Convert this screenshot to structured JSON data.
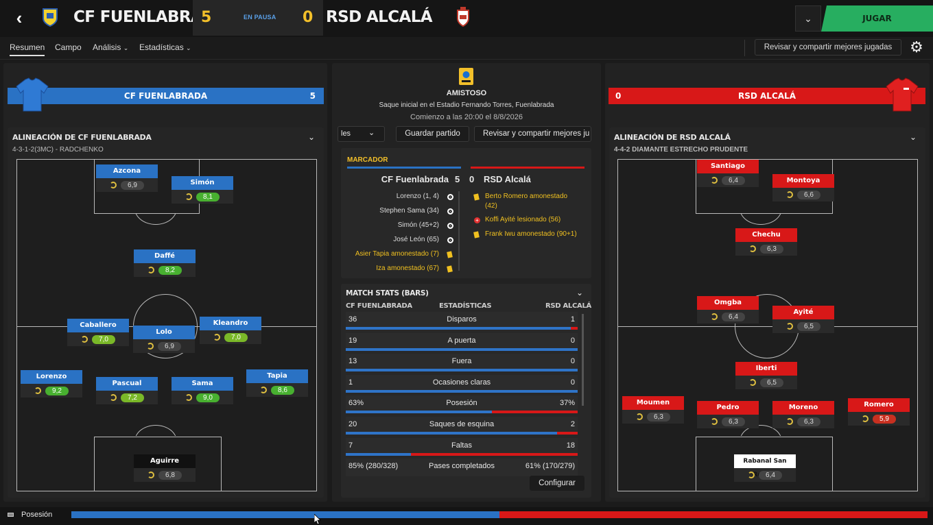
{
  "header": {
    "home_team": "CF FUENLABRADA",
    "home_score": "5",
    "status": "EN PAUSA",
    "away_score": "0",
    "away_team": "RSD ALCALÁ",
    "play_label": "JUGAR"
  },
  "tabs": [
    {
      "label": "Resumen"
    },
    {
      "label": "Campo"
    },
    {
      "label": "Análisis"
    },
    {
      "label": "Estadísticas"
    }
  ],
  "toolbar": {
    "review_label": "Revisar y compartir mejores jugadas"
  },
  "home_panel": {
    "team_label": "CF FUENLABRADA",
    "score": "5",
    "lineup_title": "ALINEACIÓN DE CF FUENLABRADA",
    "formation": "4-3-1-2(3MC) - RADCHENKO",
    "players": [
      {
        "name": "Azcona",
        "rating": "6,9",
        "grade": "none"
      },
      {
        "name": "Simón",
        "rating": "8,1",
        "grade": "green"
      },
      {
        "name": "Daffé",
        "rating": "8,2",
        "grade": "green"
      },
      {
        "name": "Caballero",
        "rating": "7,0",
        "grade": "lime"
      },
      {
        "name": "Lolo",
        "rating": "6,9",
        "grade": "none"
      },
      {
        "name": "Kleandro",
        "rating": "7,0",
        "grade": "lime"
      },
      {
        "name": "Lorenzo",
        "rating": "9,2",
        "grade": "green"
      },
      {
        "name": "Pascual",
        "rating": "7,2",
        "grade": "lime"
      },
      {
        "name": "Sama",
        "rating": "9,0",
        "grade": "green"
      },
      {
        "name": "Tapia",
        "rating": "8,6",
        "grade": "green"
      },
      {
        "name": "Aguirre",
        "rating": "6,8",
        "grade": "none"
      }
    ]
  },
  "away_panel": {
    "team_label": "RSD ALCALÁ",
    "score": "0",
    "lineup_title": "ALINEACIÓN DE RSD ALCALÁ",
    "formation": "4-4-2 DIAMANTE ESTRECHO PRUDENTE",
    "players": [
      {
        "name": "Santiago",
        "rating": "6,4",
        "grade": "none"
      },
      {
        "name": "Montoya",
        "rating": "6,6",
        "grade": "none"
      },
      {
        "name": "Chechu",
        "rating": "6,3",
        "grade": "none"
      },
      {
        "name": "Omgba",
        "rating": "6,4",
        "grade": "none"
      },
      {
        "name": "Ayité",
        "rating": "6,5",
        "grade": "none"
      },
      {
        "name": "Iberti",
        "rating": "6,5",
        "grade": "none"
      },
      {
        "name": "Moumen",
        "rating": "6,3",
        "grade": "none"
      },
      {
        "name": "Pedro",
        "rating": "6,3",
        "grade": "none"
      },
      {
        "name": "Moreno",
        "rating": "6,3",
        "grade": "none"
      },
      {
        "name": "Romero",
        "rating": "5,9",
        "grade": "red"
      },
      {
        "name": "Rabanal San Román",
        "rating": "6,4",
        "grade": "none"
      }
    ]
  },
  "match_info": {
    "competition": "AMISTOSO",
    "venue": "Saque inicial en el Estadio Fernando Torres, Fuenlabrada",
    "kickoff": "Comienzo a las 20:00 el 8/8/2026",
    "dropdown_text": "les",
    "save_label": "Guardar partido",
    "review_label": "Revisar y compartir mejores ju"
  },
  "scoreboard": {
    "title": "MARCADOR",
    "home": "CF Fuenlabrada",
    "home_score": "5",
    "away_score": "0",
    "away": "RSD Alcalá",
    "home_events": [
      {
        "text": "Lorenzo (1, 4)",
        "type": "goal"
      },
      {
        "text": "Stephen Sama (34)",
        "type": "goal"
      },
      {
        "text": "Simón (45+2)",
        "type": "goal"
      },
      {
        "text": "José León (65)",
        "type": "goal"
      },
      {
        "text": "Asier Tapia amonestado (7)",
        "type": "yellow"
      },
      {
        "text": "Iza amonestado (67)",
        "type": "yellow"
      }
    ],
    "away_events": [
      {
        "text": "Berto Romero amonestado",
        "text2": "(42)",
        "type": "yellow"
      },
      {
        "text": "Koffi Ayité lesionado (56)",
        "type": "injury"
      },
      {
        "text": "Frank Iwu amonestado (90+1)",
        "type": "yellow"
      }
    ]
  },
  "match_stats": {
    "title": "MATCH STATS (BARS)",
    "col_home": "CF FUENLABRADA",
    "col_mid": "ESTADÍSTICAS",
    "col_away": "RSD ALCALÁ",
    "rows": [
      {
        "label": "Disparos",
        "home": "36",
        "away": "1",
        "home_share": 0.97
      },
      {
        "label": "A puerta",
        "home": "19",
        "away": "0",
        "home_share": 1.0
      },
      {
        "label": "Fuera",
        "home": "13",
        "away": "0",
        "home_share": 1.0
      },
      {
        "label": "Ocasiones claras",
        "home": "1",
        "away": "0",
        "home_share": 1.0
      },
      {
        "label": "Posesión",
        "home": "63%",
        "away": "37%",
        "home_share": 0.63
      },
      {
        "label": "Saques de esquina",
        "home": "20",
        "away": "2",
        "home_share": 0.91
      },
      {
        "label": "Faltas",
        "home": "7",
        "away": "18",
        "home_share": 0.28
      },
      {
        "label": "Pases completados",
        "home": "85% (280/328)",
        "away": "61% (170/279)",
        "home_share": null
      }
    ],
    "configure_label": "Configurar"
  },
  "footer": {
    "possession_label": "Posesión",
    "home_possession": 0.5
  },
  "colors": {
    "home": "#2a72c4",
    "away": "#d81818",
    "accent_play": "#27ae60",
    "score_yellow": "#f3c02a"
  }
}
